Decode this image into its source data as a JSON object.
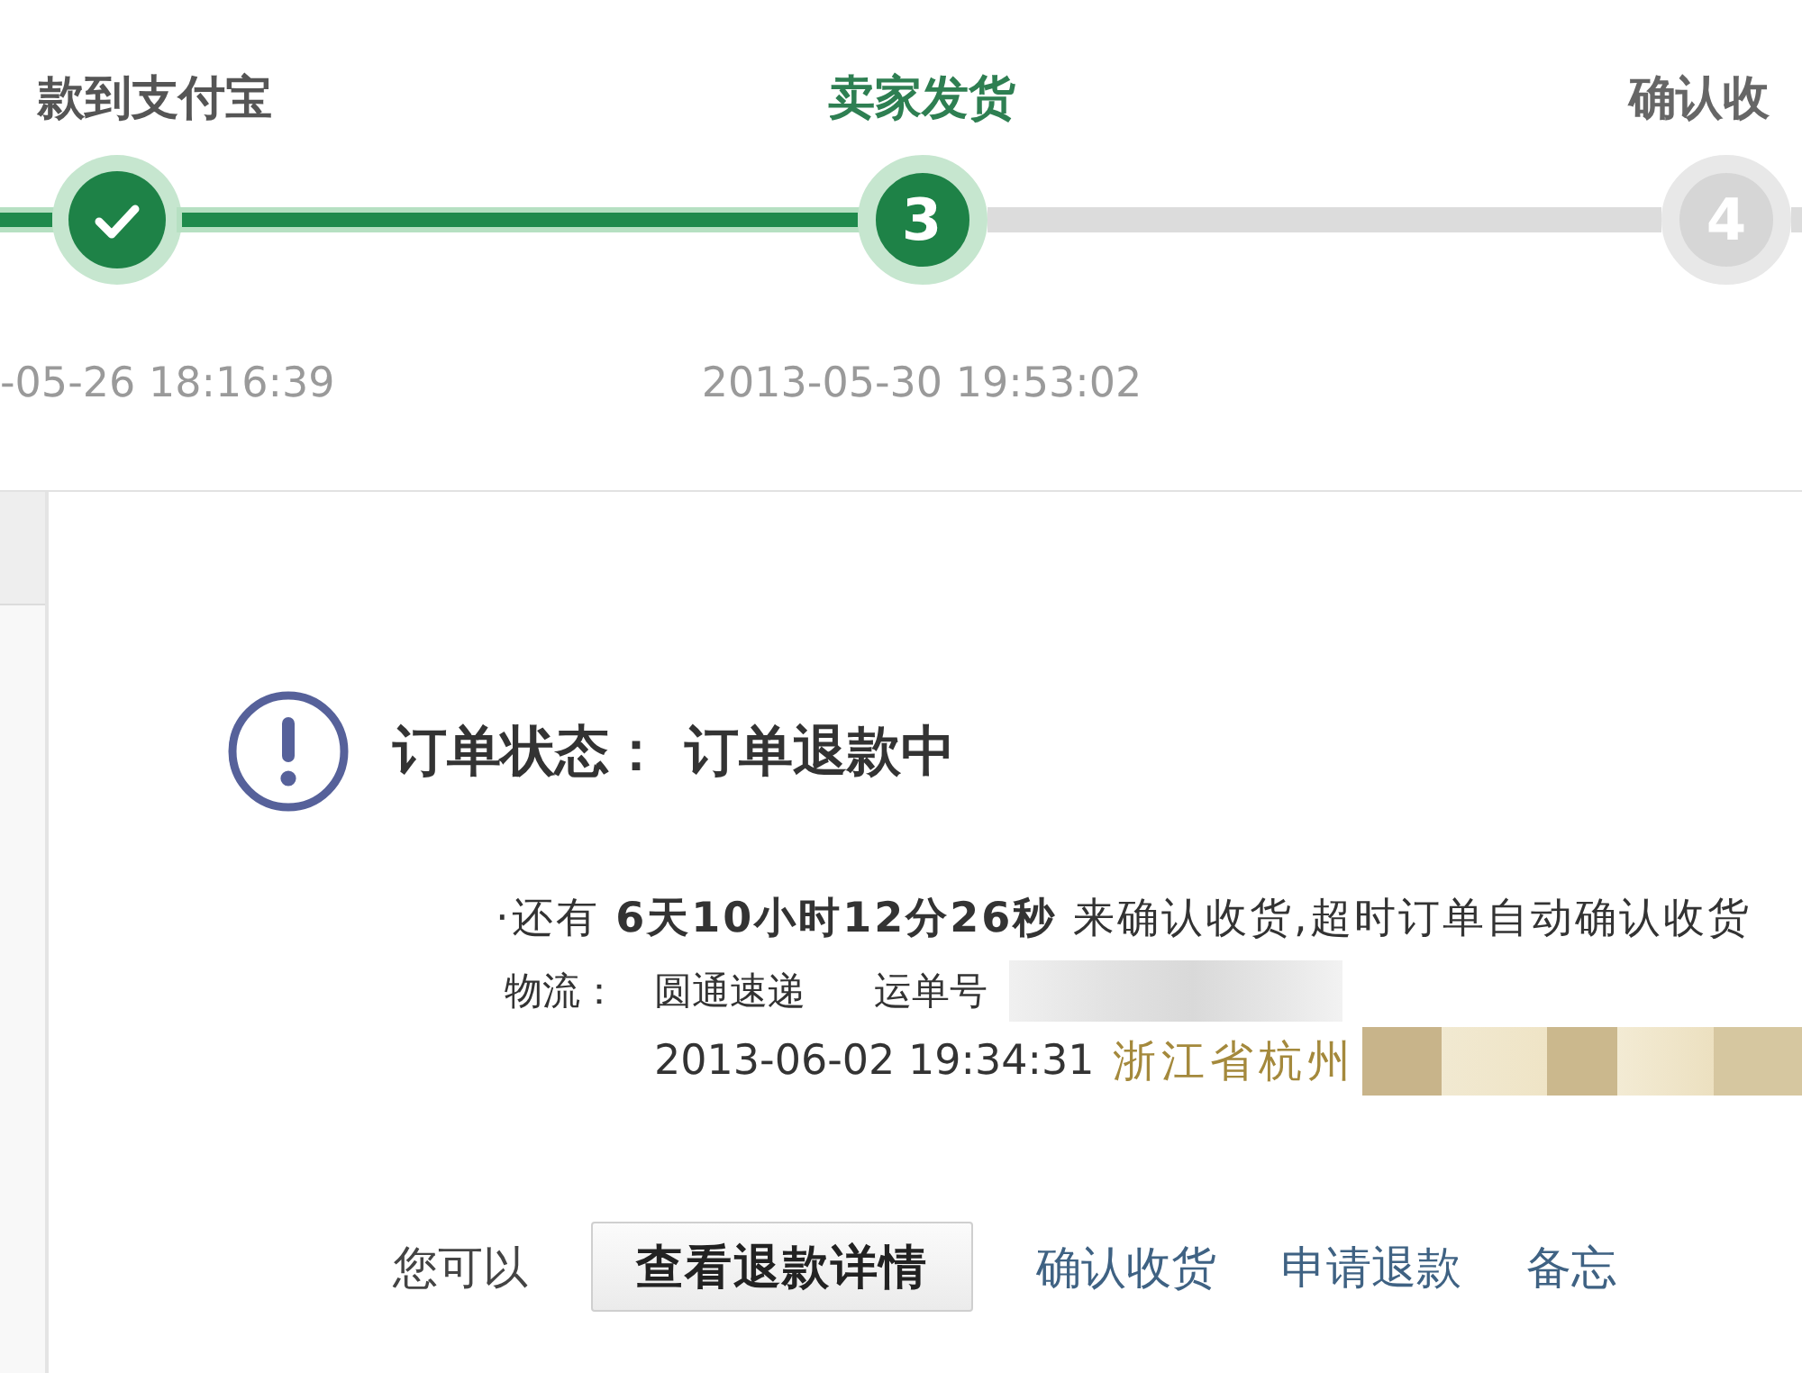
{
  "steps": [
    {
      "label": "款到支付宝",
      "completed": true,
      "current": false,
      "date": "-05-26 18:16:39"
    },
    {
      "label": "卖家发货",
      "completed": false,
      "current": true,
      "number": "3",
      "date": "2013-05-30 19:53:02"
    },
    {
      "label": "确认收",
      "completed": false,
      "current": false,
      "number": "4"
    }
  ],
  "order_status": {
    "label": "订单状态：",
    "value": "订单退款中"
  },
  "countdown": "·还有 **6天10小时12分26秒** 来确认收货,超时订单自动确认收货",
  "logistics": {
    "label": "物流：",
    "carrier": "圆通速递",
    "tracking_label": "运单号",
    "tracking_number_blurred": true,
    "update_time": "2013-06-02 19:34:31",
    "update_place": "浙江省杭州",
    "update_place_blurred": true
  },
  "actions": {
    "intro": "您可以",
    "items": [
      {
        "label": "查看退款详情",
        "kind": "button"
      },
      {
        "label": "确认收货",
        "kind": "link"
      },
      {
        "label": "申请退款",
        "kind": "link"
      },
      {
        "label": "备忘",
        "kind": "link"
      }
    ]
  }
}
